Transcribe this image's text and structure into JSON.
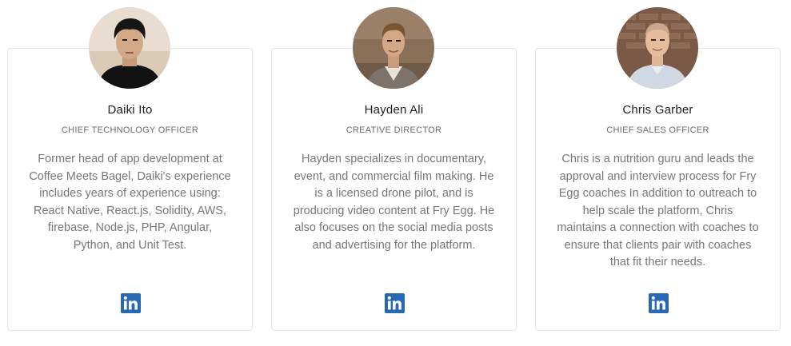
{
  "team": [
    {
      "name": "Daiki Ito",
      "role": "CHIEF TECHNOLOGY OFFICER",
      "bio": "Former head of app development at Coffee Meets Bagel, Daiki's experience includes years of experience using: React Native, React.js, Solidity, AWS, firebase, Node.js, PHP, Angular, Python, and Unit Test.",
      "social_icon": "linkedin-icon"
    },
    {
      "name": "Hayden Ali",
      "role": "CREATIVE DIRECTOR",
      "bio": "Hayden specializes in documentary, event, and commercial film making. He is a licensed drone pilot, and is producing video content at Fry Egg. He also focuses on the social media posts and advertising for the platform.",
      "social_icon": "linkedin-icon"
    },
    {
      "name": "Chris Garber",
      "role": "CHIEF SALES OFFICER",
      "bio": "Chris is a nutrition guru and leads the approval and interview process for Fry Egg coaches In addition to outreach to help scale the platform, Chris maintains a connection with coaches to ensure that clients pair with coaches that fit their needs.",
      "social_icon": "linkedin-icon"
    }
  ],
  "colors": {
    "linkedin_blue": "#2867b2",
    "name_text": "#222222",
    "role_text": "#6b6b6b",
    "bio_text": "#777777",
    "card_border": "#e6e6e6"
  }
}
